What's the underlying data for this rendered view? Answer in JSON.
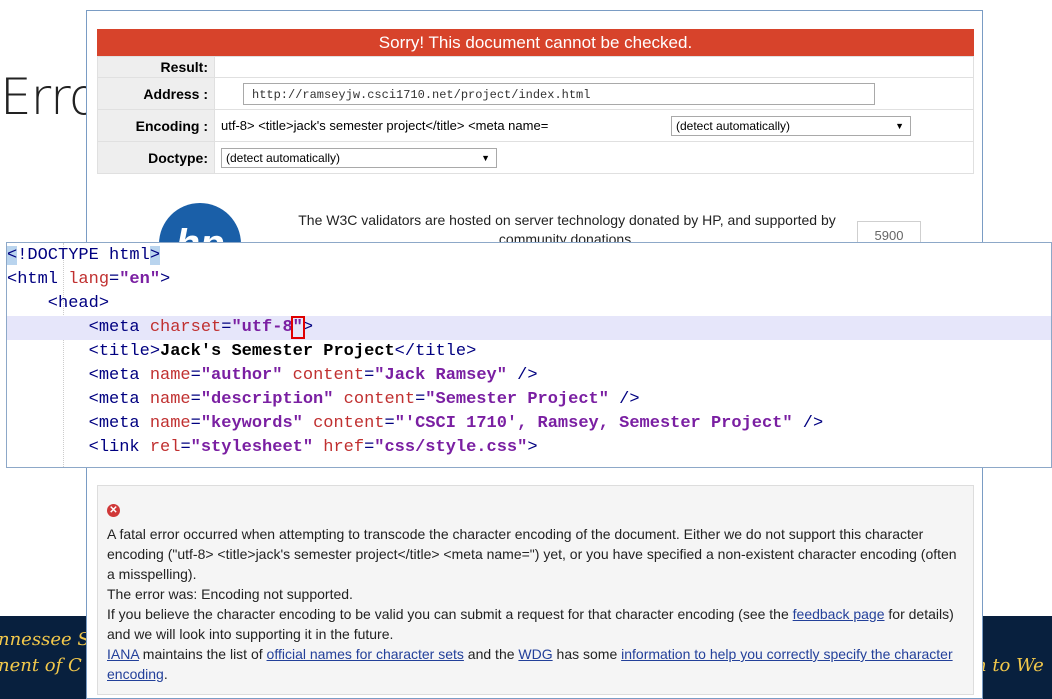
{
  "slide": {
    "title": "Erro",
    "footer_left_1": "nnessee S",
    "footer_left_2": "nent of C",
    "footer_right": "n to We"
  },
  "validator": {
    "banner": "Sorry! This document cannot be checked.",
    "result_label": "Result:",
    "result_value": "",
    "address_label": "Address :",
    "address_value": "http://ramseyjw.csci1710.net/project/index.html",
    "encoding_label": "Encoding :",
    "encoding_value": "utf-8> <title>jack's semester project</title> <meta name=",
    "encoding_select": "(detect automatically)",
    "doctype_label": "Doctype:",
    "doctype_select": "(detect automatically)",
    "sponsor_logo": "hp",
    "sponsor_text": "The W3C validators are hosted on server technology donated by HP, and supported by community donations.",
    "counter": "5900"
  },
  "code_lines": [
    "<!DOCTYPE html>",
    "<html lang=\"en\">",
    "<head>",
    "<meta charset=\"utf-8\">",
    "<title>Jack's Semester Project</title>",
    "<meta name=\"author\" content=\"Jack Ramsey\" />",
    "<meta name=\"description\" content=\"Semester Project\" />",
    "<meta name=\"keywords\" content=\"'CSCI 1710', Ramsey, Semester Project\" />",
    "<link rel=\"stylesheet\" href=\"css/style.css\">"
  ],
  "error": {
    "icon": "error-icon",
    "para1": "A fatal error occurred when attempting to transcode the character encoding of the document. Either we do not support this character encoding (\"utf-8> <title>jack's semester project</title> <meta name=\") yet, or you have specified a non-existent character encoding (often a misspelling).",
    "para2": "The error was: Encoding not supported.",
    "para3_a": "If you believe the character encoding to be valid you can submit a request for that character encoding (see the ",
    "feedback_link": "feedback page",
    "para3_b": " for details) and we will look into supporting it in the future.",
    "iana_link": "IANA",
    "para4_a": " maintains the list of ",
    "official_names_link": "official names for character sets",
    "para4_b": " and the ",
    "wdg_link": "WDG",
    "para4_c": " has some ",
    "info_link": "information to help you correctly specify the character encoding",
    "para4_d": "."
  },
  "colors": {
    "banner": "#d7432b",
    "footer": "#08203e",
    "footer_text": "#f2c84b",
    "link": "#23409a"
  }
}
